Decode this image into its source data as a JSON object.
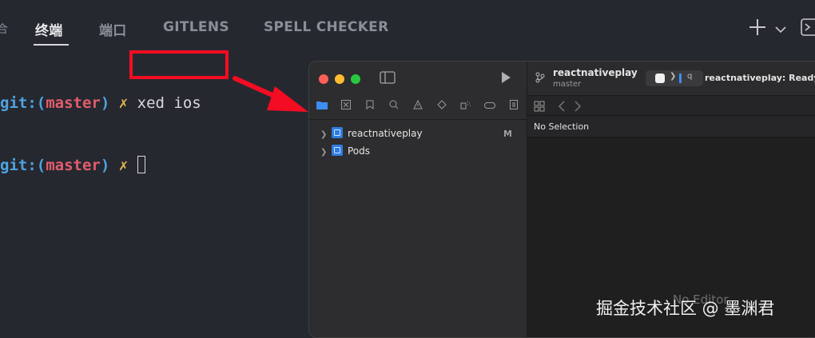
{
  "vscode_panel": {
    "tabs": [
      {
        "label": "终端",
        "active": true
      },
      {
        "label": "端口",
        "active": false
      },
      {
        "label": "GITLENS",
        "active": false
      },
      {
        "label": "SPELL CHECKER",
        "active": false
      }
    ],
    "left_edge_glyph": "合",
    "icons": [
      "plus-icon",
      "chevron-down-icon",
      "maximize-panel-icon"
    ]
  },
  "terminal": {
    "lines": [
      {
        "prefix": "git:(",
        "branch": "master",
        "suffix": ")",
        "dirty": "✗",
        "command": "xed ios"
      },
      {
        "prefix": "git:(",
        "branch": "master",
        "suffix": ")",
        "dirty": "✗",
        "command": ""
      }
    ],
    "colors": {
      "prefix": "#4fa3e0",
      "branch": "#e25d6c",
      "dirty": "#e5b64a",
      "text": "#d9d9dc"
    }
  },
  "annotation": {
    "highlight_color": "#f40c22",
    "arrow_color": "#f40c22"
  },
  "xcode": {
    "project_name": "reactnativeplay",
    "branch": "master",
    "status_text": "reactnativeplay: Ready",
    "scheme_glyph": "q",
    "navigator_items": [
      {
        "label": "reactnativeplay",
        "badge": "M"
      },
      {
        "label": "Pods",
        "badge": ""
      }
    ],
    "no_selection": "No Selection",
    "no_editor": "No Editor",
    "traffic_lights": [
      "#ff5f57",
      "#febc2e",
      "#28c840"
    ]
  },
  "watermark": "掘金技术社区 @ 墨渊君"
}
